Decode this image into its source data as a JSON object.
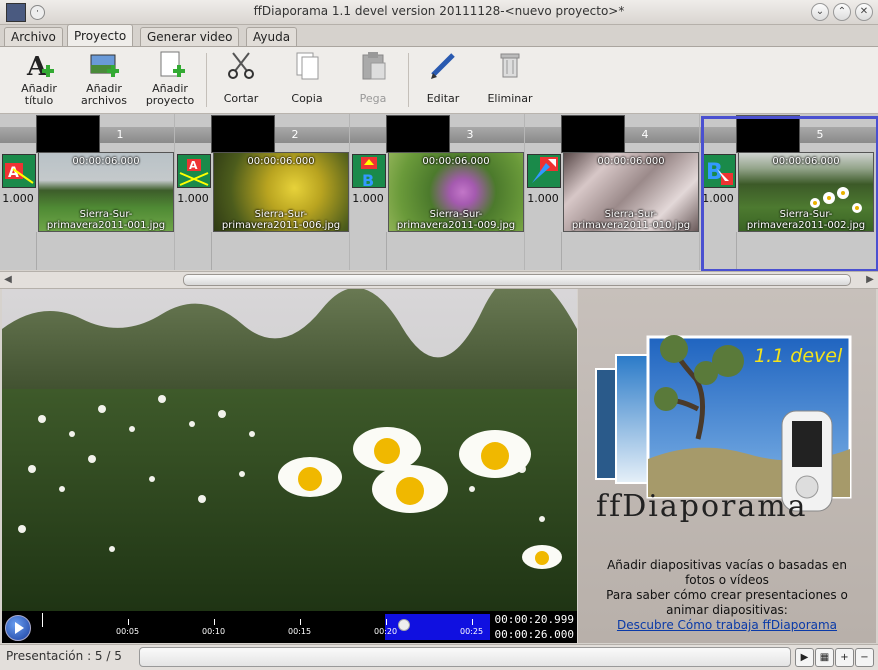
{
  "window": {
    "title": "ffDiaporama 1.1 devel version 20111128-<nuevo proyecto>*"
  },
  "menu_tabs": [
    {
      "label": "Archivo"
    },
    {
      "label": "Proyecto"
    },
    {
      "label": "Generar video"
    },
    {
      "label": "Ayuda"
    }
  ],
  "toolbar": {
    "add_title": "Añadir\ntítulo",
    "add_files": "Añadir\narchivos",
    "add_project": "Añadir\nproyecto",
    "cut": "Cortar",
    "copy": "Copia",
    "paste": "Pega",
    "edit": "Editar",
    "delete": "Eliminar"
  },
  "slides": [
    {
      "number": "1",
      "duration": "1.000",
      "time": "00:00:06.000",
      "file1": "Sierra-Sur-",
      "file2": "primavera2011-001.jpg"
    },
    {
      "number": "2",
      "duration": "1.000",
      "time": "00:00:06.000",
      "file1": "Sierra-Sur-",
      "file2": "primavera2011-006.jpg"
    },
    {
      "number": "3",
      "duration": "1.000",
      "time": "00:00:06.000",
      "file1": "Sierra-Sur-",
      "file2": "primavera2011-009.jpg"
    },
    {
      "number": "4",
      "duration": "1.000",
      "time": "00:00:06.000",
      "file1": "Sierra-Sur-",
      "file2": "primavera2011-010.jpg"
    },
    {
      "number": "5",
      "duration": "1.000",
      "time": "00:00:06.000",
      "file1": "Sierra-Sur-",
      "file2": "primavera2011-002.jpg"
    }
  ],
  "player": {
    "ticks": [
      "00:05",
      "00:10",
      "00:15",
      "00:20",
      "00:25"
    ],
    "current_time": "00:00:20.999",
    "total_time": "00:00:26.000"
  },
  "info": {
    "version_badge": "1.1 devel",
    "logo_text": "ffDiaporama",
    "line1": "Añadir diapositivas vacías o basadas en",
    "line2": "fotos o vídeos",
    "line3": "Para saber cómo crear presentaciones o",
    "line4": "animar diapositivas:",
    "link": "Descubre Cómo trabaja ffDiaporama"
  },
  "status": {
    "presentation": "Presentación : 5 / 5"
  }
}
